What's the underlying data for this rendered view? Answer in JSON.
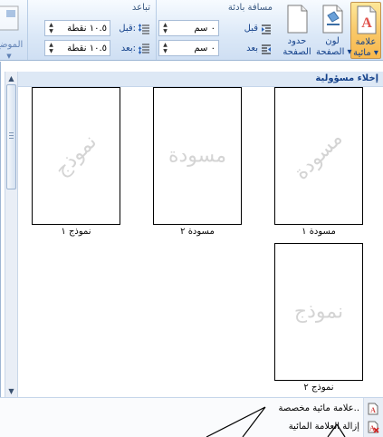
{
  "ribbon": {
    "watermark_btn": {
      "label_line1": "علامة",
      "label_line2": "مائية ▾"
    },
    "page_color_btn": {
      "label_line1": "لون",
      "label_line2": "الصفحة ▾"
    },
    "page_borders_btn": {
      "label_line1": "حدود",
      "label_line2": "الصفحة"
    },
    "indent": {
      "title": "مسافة بادئة",
      "before_label": "قبل",
      "before_value": "٠ سم",
      "after_label": "بعد",
      "after_value": "٠ سم"
    },
    "spacing": {
      "title": "تباعد",
      "before_label": "قبل:",
      "before_value": "١٠.٥ نقطة",
      "after_label": "بعد:",
      "after_value": "١٠.٥ نقطة"
    },
    "position_btn": {
      "label": "الموضع"
    }
  },
  "gallery": {
    "category_header": "إخلاء مسؤولية",
    "tiles": [
      {
        "watermark": "مسودة",
        "caption": "مسودة ١"
      },
      {
        "watermark": "مسودة",
        "caption": "مسودة ٢"
      },
      {
        "watermark": "نموذج",
        "caption": "نموذج ١"
      },
      {
        "watermark": "نموذج",
        "caption": "نموذج ٢"
      }
    ]
  },
  "menu": {
    "items": [
      {
        "label": "علامة مائية مخصصة..",
        "icon": "custom-watermark-icon"
      },
      {
        "label": "إزالة العلامة المائية",
        "icon": "remove-watermark-icon"
      }
    ]
  },
  "colors": {
    "ribbon_bg": "#dbe8f7",
    "active_button": "#f9c96a",
    "text_blue": "#15428b",
    "watermark_gray": "#d4d4d4"
  }
}
